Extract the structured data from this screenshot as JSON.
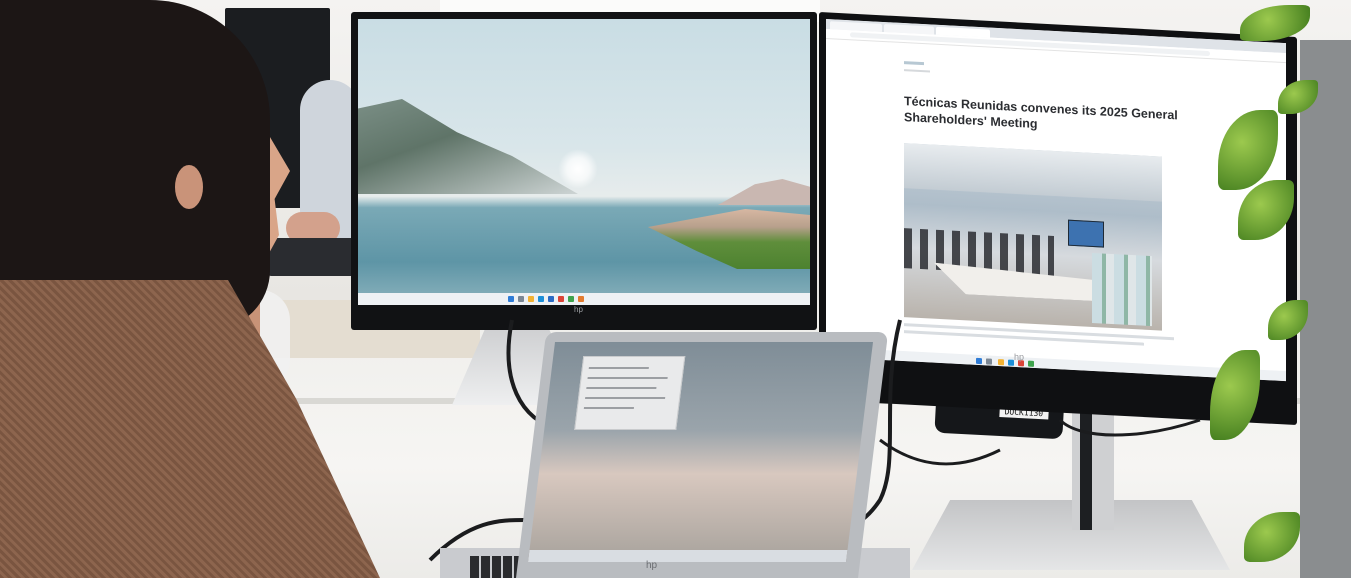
{
  "scene": "woman working at desk with two monitors and a laptop",
  "right_monitor": {
    "article_title_line1": "Técnicas Reunidas convenes its 2025 General",
    "article_title_line2": "Shareholders' Meeting"
  },
  "dock_label": "DOCK1130",
  "colors": {
    "desk": "#efeeeb",
    "monitor_bezel": "#111214",
    "jacket": "#7a5540",
    "leaf": "#6aa332"
  },
  "icons": [
    "hp-logo-icon",
    "windows-start-icon"
  ]
}
